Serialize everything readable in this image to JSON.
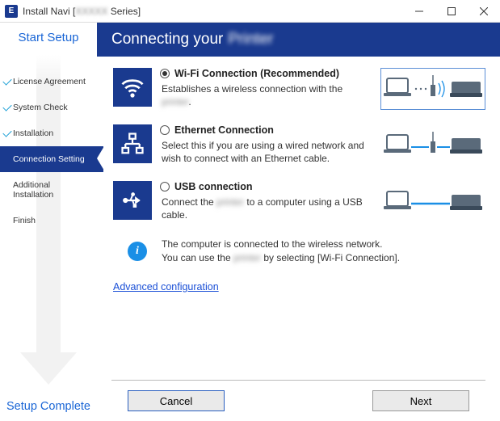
{
  "titlebar": {
    "app_icon_letter": "E",
    "title_prefix": "Install Navi [",
    "title_blur": "XXXXX",
    "title_suffix": " Series]"
  },
  "sidebar": {
    "start": "Start Setup",
    "complete": "Setup Complete",
    "steps": [
      {
        "label": "License Agreement",
        "checked": true,
        "active": false
      },
      {
        "label": "System Check",
        "checked": true,
        "active": false
      },
      {
        "label": "Installation",
        "checked": true,
        "active": false
      },
      {
        "label": "Connection Setting",
        "checked": false,
        "active": true
      },
      {
        "label": "Additional Installation",
        "checked": false,
        "active": false
      },
      {
        "label": "Finish",
        "checked": false,
        "active": false
      }
    ]
  },
  "header": {
    "prefix": "Connecting your",
    "blur": "Printer"
  },
  "options": {
    "wifi": {
      "title": "Wi-Fi Connection (Recommended)",
      "desc_pre": "Establishes a wireless connection with the ",
      "desc_blur": "printer",
      "desc_post": ".",
      "selected": true
    },
    "ethernet": {
      "title": "Ethernet Connection",
      "desc": "Select this if you are using a wired network and wish to connect with an Ethernet cable."
    },
    "usb": {
      "title": "USB connection",
      "desc_pre": "Connect the ",
      "desc_blur": "printer",
      "desc_post": " to a computer using a USB cable."
    }
  },
  "info": {
    "line1": "The computer is connected to the wireless network.",
    "line2_pre": "You can use the ",
    "line2_blur": "printer",
    "line2_post": " by selecting [Wi-Fi Connection]."
  },
  "advanced_link": "Advanced configuration",
  "buttons": {
    "cancel": "Cancel",
    "next": "Next"
  }
}
